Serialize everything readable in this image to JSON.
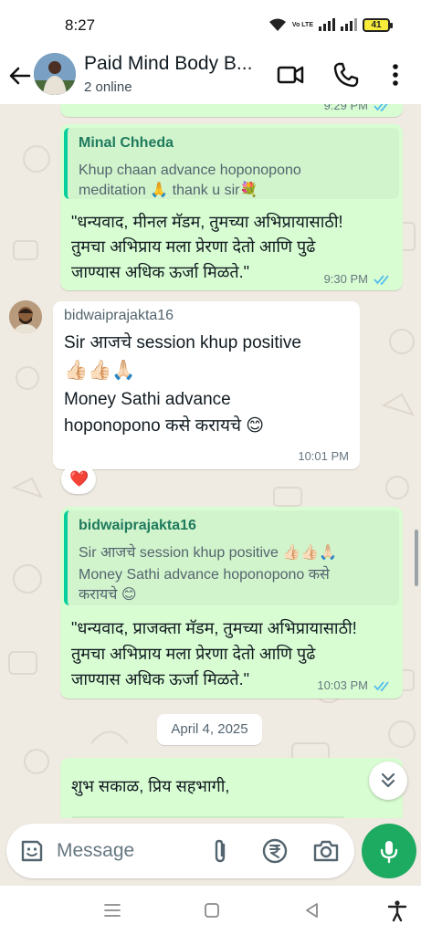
{
  "status_bar": {
    "time": "8:27",
    "volte": "Vo LTE",
    "battery": "41"
  },
  "header": {
    "title": "Paid Mind Body B...",
    "subtitle": "2 online"
  },
  "messages": {
    "partial_top": {
      "time": "9:29 PM"
    },
    "reply1": {
      "quote_author": "Minal Chheda",
      "quote_line1": "Khup chaan advance hoponopono",
      "quote_line2": "meditation 🙏 thank u sir💐",
      "line1": "\"धन्यवाद, मीनल मॅडम, तुमच्या अभिप्रायासाठी!",
      "line2": "तुमचा अभिप्राय मला प्रेरणा देतो आणि पुढे",
      "line3": "जाण्यास अधिक ऊर्जा मिळते.\"",
      "time": "9:30 PM"
    },
    "incoming1": {
      "sender": "bidwaiprajakta16",
      "line1": "Sir आजचे session khup positive",
      "line2": "👍🏻👍🏻🙏🏻",
      "line3": "Money Sathi advance",
      "line4": "hoponopono कसे करायचे 😊",
      "time": "10:01 PM",
      "reaction": "❤️"
    },
    "reply2": {
      "quote_author": "bidwaiprajakta16",
      "quote_line1": "Sir आजचे session khup positive 👍🏻👍🏻🙏🏻",
      "quote_line2": "Money Sathi advance hoponopono कसे",
      "quote_line3": "करायचे 😊",
      "line1": "\"धन्यवाद, प्राजक्ता मॅडम, तुमच्या अभिप्रायासाठी!",
      "line2": "तुमचा अभिप्राय मला प्रेरणा देतो आणि पुढे",
      "line3": "जाण्यास अधिक ऊर्जा मिळते.\"",
      "time": "10:03 PM"
    },
    "date_divider": "April 4, 2025",
    "last": {
      "line1": "शुभ सकाळ, प्रिय सहभागी,"
    }
  },
  "compose": {
    "placeholder": "Message"
  },
  "colors": {
    "outgoing": "#d9fdd3",
    "incoming": "#ffffff",
    "accent": "#1daa61",
    "read_ticks": "#53bdeb",
    "background": "#efeae2"
  },
  "icons": [
    "back-arrow-icon",
    "video-call-icon",
    "voice-call-icon",
    "more-options-icon",
    "sticker-icon",
    "attach-icon",
    "rupee-payment-icon",
    "camera-icon",
    "mic-icon",
    "chevron-double-down-icon",
    "recents-nav-icon",
    "home-nav-icon",
    "back-nav-icon",
    "accessibility-icon"
  ]
}
